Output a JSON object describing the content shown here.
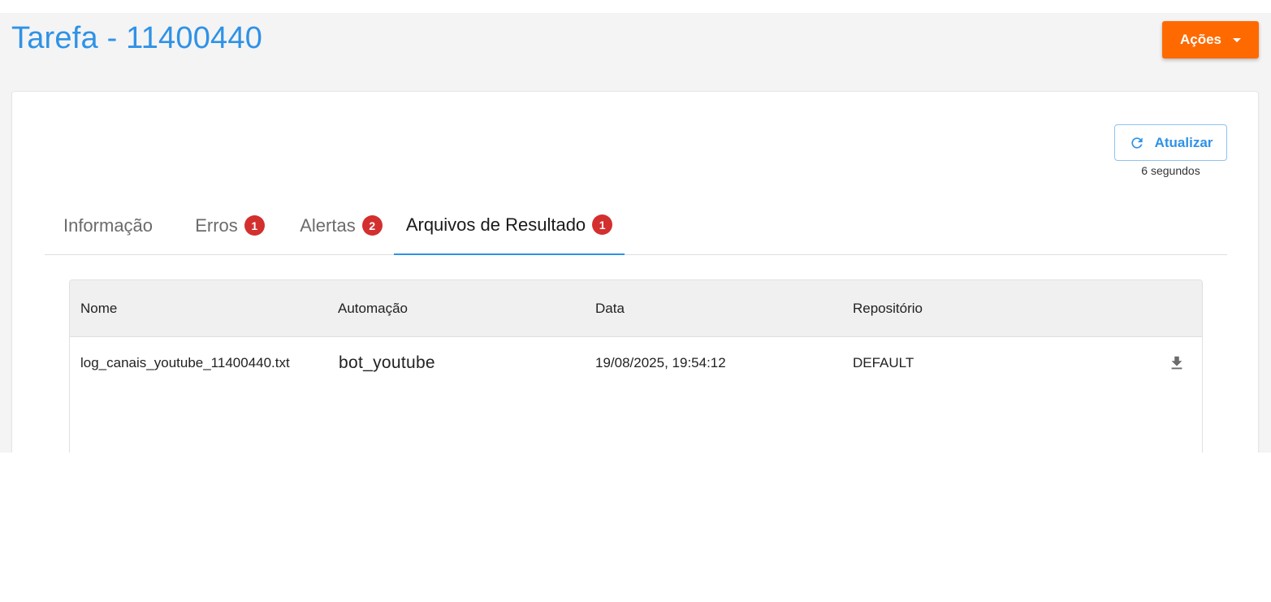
{
  "header": {
    "title": "Tarefa - 11400440",
    "actions_label": "Ações"
  },
  "refresh": {
    "label": "Atualizar",
    "note": "6 segundos"
  },
  "tabs": [
    {
      "label": "Informação",
      "badge": null
    },
    {
      "label": "Erros",
      "badge": "1"
    },
    {
      "label": "Alertas",
      "badge": "2"
    },
    {
      "label": "Arquivos de Resultado",
      "badge": "1",
      "active": true
    }
  ],
  "table": {
    "columns": [
      "Nome",
      "Automação",
      "Data",
      "Repositório"
    ],
    "rows": [
      {
        "nome": "log_canais_youtube_11400440.txt",
        "automacao": "bot_youtube",
        "data": "19/08/2025, 19:54:12",
        "repositorio": "DEFAULT",
        "action_icon": "download-icon"
      }
    ]
  },
  "colors": {
    "primary": "#2f92e6",
    "actions": "#ff6a00",
    "badge": "#d32f2f"
  }
}
